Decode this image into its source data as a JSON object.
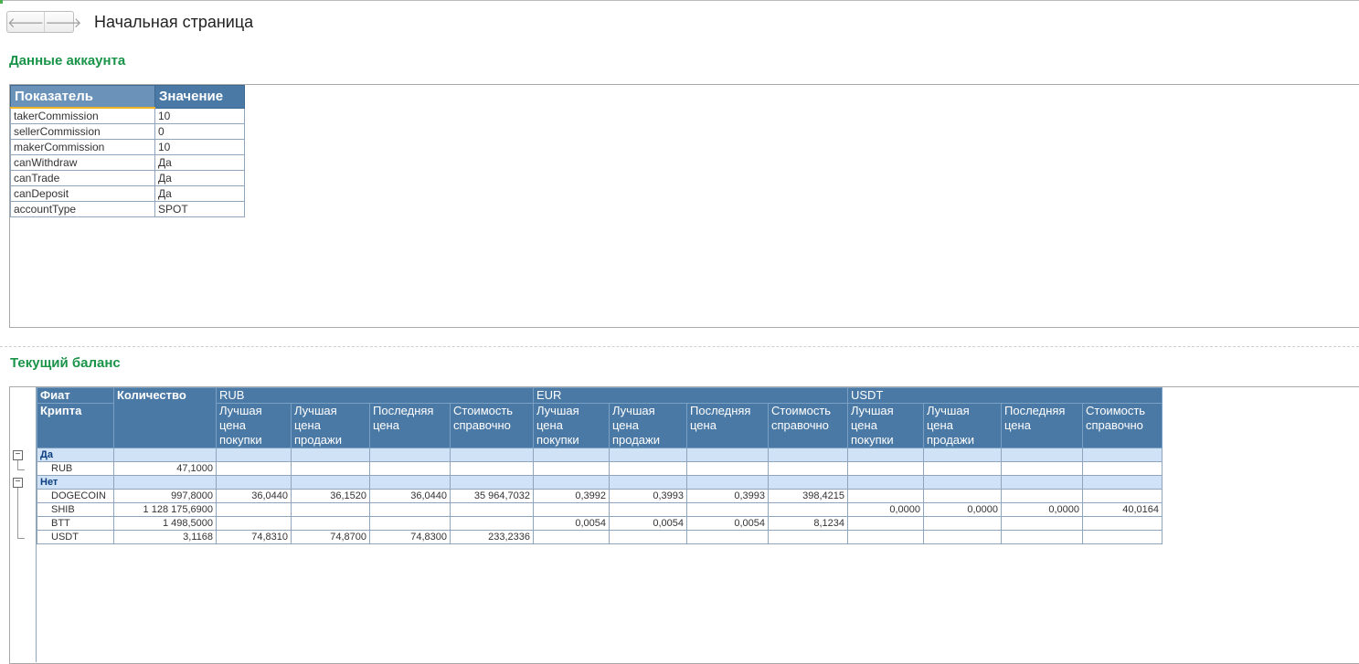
{
  "page": {
    "title": "Начальная страница"
  },
  "nav": {
    "back_icon": "arrow-left-icon",
    "forward_icon": "arrow-right-icon",
    "back_glyph": "🡐",
    "forward_glyph": "🡒"
  },
  "account": {
    "section_title": "Данные аккаунта",
    "headers": [
      "Показатель",
      "Значение"
    ],
    "rows": [
      {
        "name": "takerCommission",
        "value": "10"
      },
      {
        "name": "sellerCommission",
        "value": "0"
      },
      {
        "name": "makerCommission",
        "value": "10"
      },
      {
        "name": "canWithdraw",
        "value": "Да"
      },
      {
        "name": "canTrade",
        "value": "Да"
      },
      {
        "name": "canDeposit",
        "value": "Да"
      },
      {
        "name": "accountType",
        "value": "SPOT"
      }
    ]
  },
  "balance": {
    "section_title": "Текущий баланс",
    "header": {
      "fiat": "Фиат",
      "crypto": "Крипта",
      "qty": "Количество",
      "currencies": [
        "RUB",
        "EUR",
        "USDT"
      ],
      "subcols": [
        "Лучшая цена покупки",
        "Лучшая цена продажи",
        "Последняя цена",
        "Стоимость справочно"
      ]
    },
    "toggle_glyph": "−",
    "groups": [
      {
        "label": "Да",
        "rows": [
          {
            "name": "RUB",
            "qty": "47,1000",
            "vals": [
              "",
              "",
              "",
              "",
              "",
              "",
              "",
              "",
              "",
              "",
              "",
              ""
            ]
          }
        ]
      },
      {
        "label": "Нет",
        "rows": [
          {
            "name": "DOGECOIN",
            "qty": "997,8000",
            "vals": [
              "36,0440",
              "36,1520",
              "36,0440",
              "35 964,7032",
              "0,3992",
              "0,3993",
              "0,3993",
              "398,4215",
              "",
              "",
              "",
              ""
            ]
          },
          {
            "name": "SHIB",
            "qty": "1 128 175,6900",
            "vals": [
              "",
              "",
              "",
              "",
              "",
              "",
              "",
              "",
              "0,0000",
              "0,0000",
              "0,0000",
              "40,0164"
            ]
          },
          {
            "name": "BTT",
            "qty": "1 498,5000",
            "vals": [
              "",
              "",
              "",
              "",
              "0,0054",
              "0,0054",
              "0,0054",
              "8,1234",
              "",
              "",
              "",
              ""
            ]
          },
          {
            "name": "USDT",
            "qty": "3,1168",
            "vals": [
              "74,8310",
              "74,8700",
              "74,8300",
              "233,2336",
              "",
              "",
              "",
              "",
              "",
              "",
              "",
              ""
            ]
          }
        ]
      }
    ]
  }
}
